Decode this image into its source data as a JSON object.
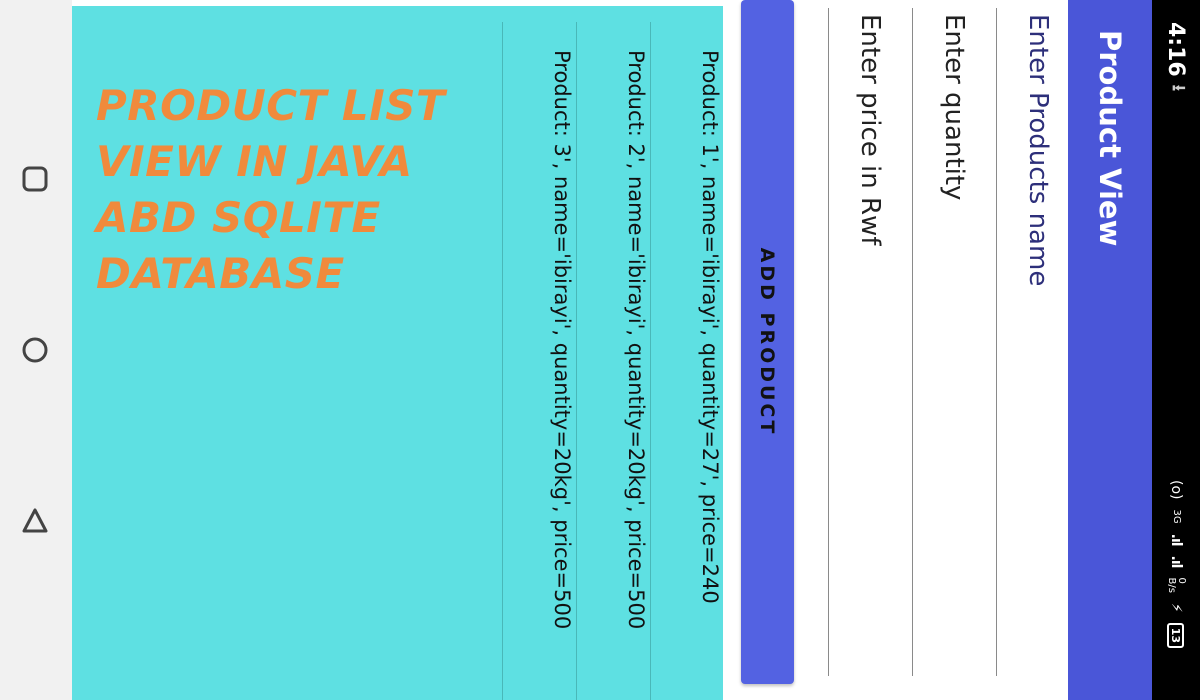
{
  "status_bar": {
    "time": "4:16",
    "upload_icon": "upload-arrow-icon",
    "hotspot_icon": "(o)",
    "network_type": "3G",
    "signal_text_1": ".ıl",
    "signal_text_2": ".ıl",
    "data_speed_value": "0",
    "data_speed_unit": "B/s",
    "charging_icon": "⚡",
    "battery_level": "13"
  },
  "app_bar": {
    "title": "Product View"
  },
  "form": {
    "name_placeholder": "Enter Products name",
    "quantity_placeholder": "Enter quantity",
    "price_placeholder": "Enter price in Rwf",
    "add_button_label": "ADD PRODUCT"
  },
  "product_list": {
    "items": [
      "Product: 1', name='ibirayi', quantity=27', price=240",
      "Product: 2', name='ibirayi', quantity=20kg', price=500",
      "Product: 3', name='ibirayi', quantity=20kg', price=500"
    ]
  },
  "overlay": {
    "title_text": "PRODUCT LIST VIEW IN JAVA ABD SQLITE DATABASE"
  },
  "nav_bar": {
    "recents_icon": "square-icon",
    "home_icon": "circle-icon",
    "back_icon": "triangle-icon"
  },
  "colors": {
    "app_bar": "#4a56d8",
    "button": "#5362e2",
    "list_background": "#5ee0e2",
    "overlay_text": "#f08a3c",
    "name_placeholder_text": "#2d2f7a"
  }
}
